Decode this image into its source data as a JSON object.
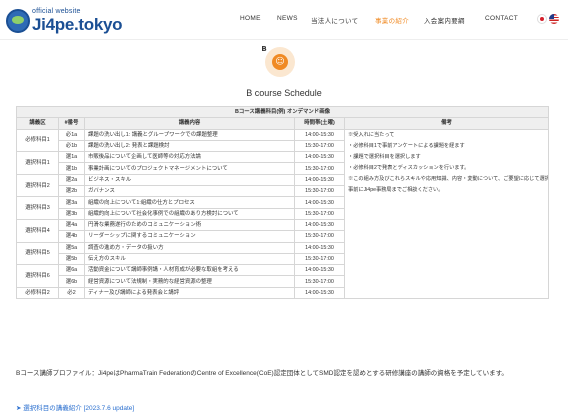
{
  "header": {
    "logo_small": "official website",
    "logo_main": "Ji4pe.tokyo",
    "nav": [
      "HOME",
      "NEWS",
      "当法人について",
      "事業の紹介",
      "入会案内要綱",
      "CONTACT"
    ],
    "active_nav": "事業の紹介",
    "active_color": "#f08a24"
  },
  "badge": {
    "letter": "B",
    "icon": "running-person-icon"
  },
  "page_title": "B course Schedule",
  "table": {
    "caption": "Bコース講義科目(例) オンデマンド画像",
    "headers": [
      "講義区",
      "#番号",
      "講義内容",
      "時間帯(土曜)",
      "備考"
    ],
    "rows": [
      {
        "group": "必修科目1",
        "rowspan": 2,
        "num": "必1a",
        "content": "課題の洗い出し1: 講義とグループワークでの課題整理",
        "time": "14:00-15:30"
      },
      {
        "num": "必1b",
        "content": "課題の洗い出し2: 発表と課題検討",
        "time": "15:30-17:00"
      },
      {
        "group": "選択科目1",
        "rowspan": 2,
        "num": "選1a",
        "content": "市販後品について企画して医師等の対応方法論",
        "time": "14:00-15:30"
      },
      {
        "num": "選1b",
        "content": "事業計画についてのプロジェクトマネージメントについて",
        "time": "15:30-17:00"
      },
      {
        "group": "選択科目2",
        "rowspan": 2,
        "num": "選2a",
        "content": "ビジネス・スキル",
        "time": "14:00-15:30"
      },
      {
        "num": "選2b",
        "content": "ガバナンス",
        "time": "15:30-17:00"
      },
      {
        "group": "選択科目3",
        "rowspan": 2,
        "num": "選3a",
        "content": "組織の向上について1:組織の仕方とプロセス",
        "time": "14:00-15:30"
      },
      {
        "num": "選3b",
        "content": "組織的向上について社会化事例での組織のあり方検討について",
        "time": "15:30-17:00"
      },
      {
        "group": "選択科目4",
        "rowspan": 2,
        "num": "選4a",
        "content": "円滑な業務遂行のためのコミュニケーション術",
        "time": "14:00-15:30"
      },
      {
        "num": "選4b",
        "content": "リーダーシップに関するコミュニケーション",
        "time": "15:30-17:00"
      },
      {
        "group": "選択科目5",
        "rowspan": 2,
        "num": "選5a",
        "content": "調査の進め方・データの扱い方",
        "time": "14:00-15:30"
      },
      {
        "num": "選5b",
        "content": "伝え方のスキル",
        "time": "15:30-17:00"
      },
      {
        "group": "選択科目6",
        "rowspan": 2,
        "num": "選6a",
        "content": "活動資金について講師事例講・人材育成が必要な取組を考える",
        "time": "14:00-15:30"
      },
      {
        "num": "選6b",
        "content": "経営資源について法規制・実務的な経営資源の整理",
        "time": "15:30-17:00"
      },
      {
        "group": "必修科目2",
        "rowspan": 1,
        "num": "必2",
        "content": "ディナー及び講師による発表会と講評",
        "time": "14:00-15:30"
      }
    ],
    "remarks": [
      "※受入れに当たって",
      "・必修科目1で事前アンケートによる課題を経ます",
      "・課題で選択科目を選択します",
      "・必修科目2で発表とディスカッションを行います。",
      "※この組み方及びこれらスキルや応用知識、内容・変動について、ご要望に応じて選択科目を追加調整致します。",
      "事前にJi4pe事務局までご相談ください。"
    ]
  },
  "footnote": "Bコース講師プロファイル：Ji4peはPharmaTrain FederationのCentre of Excellence(CoE)認定団体としてSMD認定を認めとする研修講座の講師の資格を予定しています。",
  "update_link": "選択科目の講義紹介 [2023.7.6 update]"
}
